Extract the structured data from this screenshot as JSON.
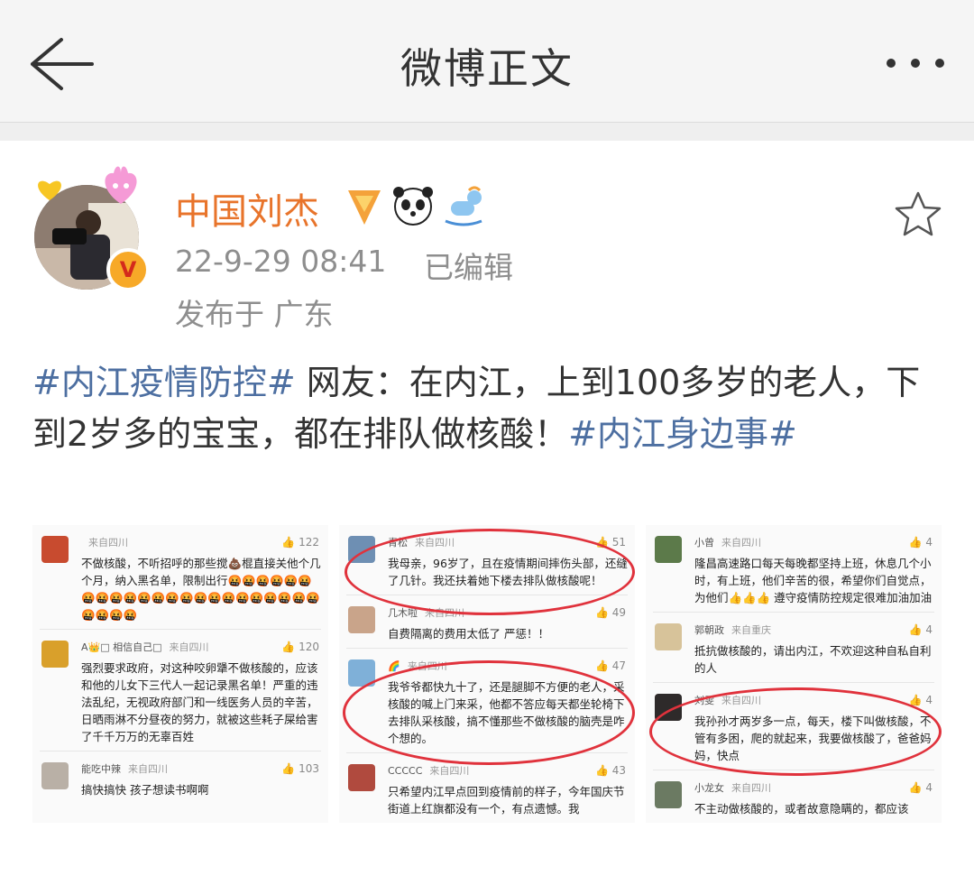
{
  "header": {
    "title": "微博正文",
    "back_icon": "arrow-left-icon",
    "more_icon": "ellipsis-icon"
  },
  "post": {
    "author": "中国刘杰",
    "avatar_badge": "V",
    "time": "22-9-29 08:41",
    "edited": "已编辑",
    "location": "发布于 广东",
    "content": {
      "tag1": "#内江疫情防控#",
      "text": " 网友：在内江，上到100多岁的老人，下到2岁多的宝宝，都在排队做核酸！",
      "tag2": "#内江身边事#"
    }
  },
  "images": [
    {
      "comments": [
        {
          "name": "",
          "source": "来自四川",
          "likes": "122",
          "text": "不做核酸，不听招呼的那些搅💩棍直接关他个几个月，纳入黑名单，限制出行🤬🤬🤬🤬🤬🤬🤬🤬🤬🤬🤬🤬🤬🤬🤬🤬🤬🤬🤬🤬🤬🤬🤬🤬🤬🤬🤬"
        },
        {
          "name": "A👑□  相信自己□",
          "source": "来自四川",
          "likes": "120",
          "text": "强烈要求政府，对这种咬卵犟不做核酸的，应该和他的儿女下三代人一起记录黑名单！严重的违法乱纪，无视政府部门和一线医务人员的辛苦，日晒雨淋不分昼夜的努力，就被这些耗子屎给害了千千万万的无辜百姓"
        },
        {
          "name": "能吃中辣",
          "source": "来自四川",
          "likes": "103",
          "text": "搞快搞快 孩子想读书啊啊"
        }
      ]
    },
    {
      "comments": [
        {
          "name": "青松",
          "source": "来自四川",
          "likes": "51",
          "text": "我母亲，96岁了，且在疫情期间摔伤头部，还缝了几针。我还扶着她下楼去排队做核酸呢！"
        },
        {
          "name": "几木啦",
          "source": "来自四川",
          "likes": "49",
          "text": "自费隔离的费用太低了 严惩！！"
        },
        {
          "name": "🌈",
          "source": "来自四川",
          "likes": "47",
          "text": "我爷爷都快九十了，还是腿脚不方便的老人，采核酸的喊上门来采，他都不答应每天都坐轮椅下去排队采核酸，搞不懂那些不做核酸的脑壳是咋个想的。"
        },
        {
          "name": "CCCCC",
          "source": "来自四川",
          "likes": "43",
          "text": "只希望内江早点回到疫情前的样子，今年国庆节街道上红旗都没有一个，有点遗憾。我"
        }
      ]
    },
    {
      "comments": [
        {
          "name": "小曾",
          "source": "来自四川",
          "likes": "4",
          "text": "隆昌高速路口每天每晚都坚持上班，休息几个小时，有上班，他们辛苦的很，希望你们自觉点，为他们👍👍👍 遵守疫情防控规定很难加油加油"
        },
        {
          "name": "郭朝政",
          "source": "来自重庆",
          "likes": "4",
          "text": "抵抗做核酸的，请出内江，不欢迎这种自私自利的人"
        },
        {
          "name": "刘雯",
          "source": "来自四川",
          "likes": "4",
          "text": "我孙孙才两岁多一点，每天，楼下叫做核酸，不管有多困，爬的就起来，我要做核酸了，爸爸妈妈，快点"
        },
        {
          "name": "小龙女",
          "source": "来自四川",
          "likes": "4",
          "text": "不主动做核酸的，或者故意隐瞒的，都应该"
        }
      ]
    }
  ]
}
